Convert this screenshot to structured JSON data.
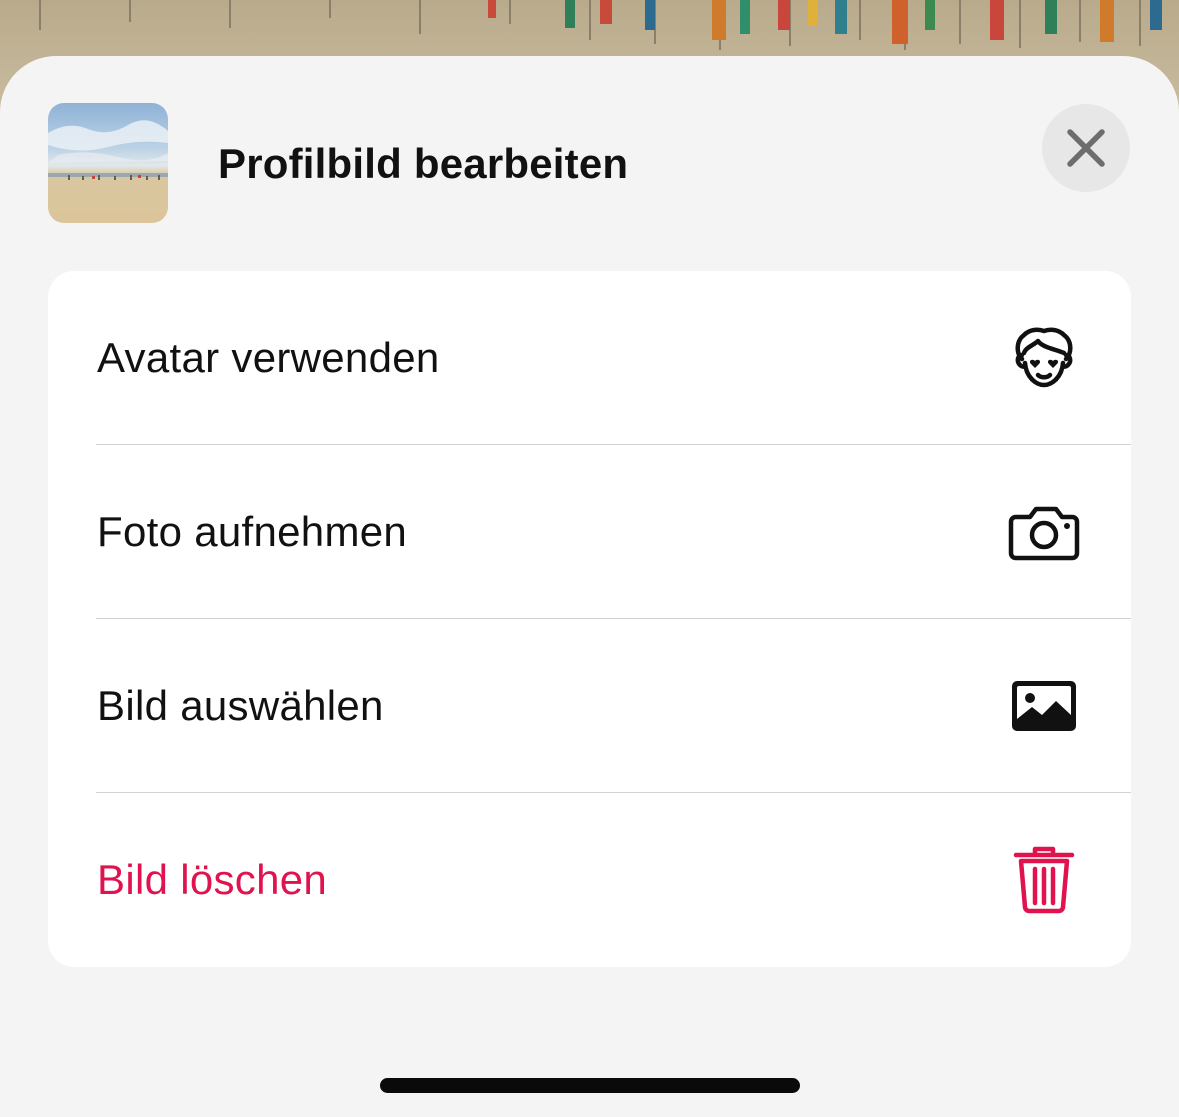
{
  "sheet": {
    "title": "Profilbild bearbeiten",
    "close_icon": "close-icon"
  },
  "options": [
    {
      "label": "Avatar verwenden",
      "icon": "avatar-face-icon"
    },
    {
      "label": "Foto aufnehmen",
      "icon": "camera-icon"
    },
    {
      "label": "Bild auswählen",
      "icon": "photo-icon"
    },
    {
      "label": "Bild löschen",
      "icon": "trash-icon",
      "color": "#e0134f"
    }
  ],
  "colors": {
    "sheet_background": "#f4f4f4",
    "card_background": "#ffffff",
    "danger": "#e0134f",
    "text": "#111111"
  }
}
